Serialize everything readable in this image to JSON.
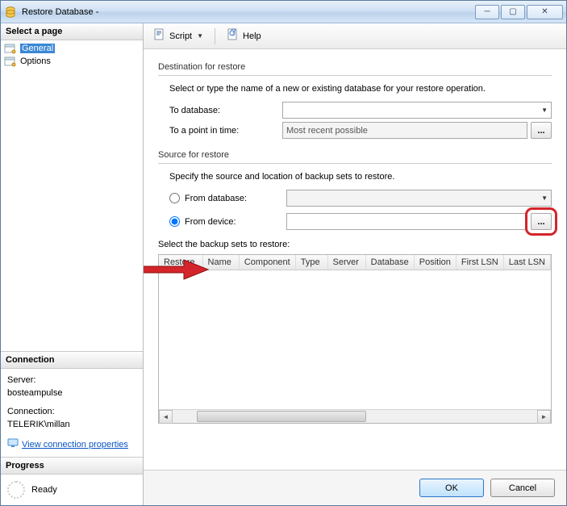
{
  "window": {
    "title": "Restore Database -"
  },
  "sidebar": {
    "selectPage": "Select a page",
    "pages": [
      {
        "label": "General",
        "selected": true
      },
      {
        "label": "Options",
        "selected": false
      }
    ],
    "connectionHeader": "Connection",
    "serverLabel": "Server:",
    "serverValue": "bosteampulse",
    "connectionLabel": "Connection:",
    "connectionValue": "TELERIK\\millan",
    "viewConnProps": "View connection properties",
    "progressHeader": "Progress",
    "progressStatus": "Ready"
  },
  "toolbar": {
    "script": "Script",
    "help": "Help"
  },
  "dest": {
    "group": "Destination for restore",
    "instruction": "Select or type the name of a new or existing database for your restore operation.",
    "toDatabaseLabel": "To database:",
    "toDatabaseValue": "",
    "toPointLabel": "To a point in time:",
    "toPointValue": "Most recent possible"
  },
  "source": {
    "group": "Source for restore",
    "instruction": "Specify the source and location of backup sets to restore.",
    "fromDatabaseLabel": "From database:",
    "fromDeviceLabel": "From device:",
    "selectedRadio": "device",
    "deviceValue": "",
    "backupSetsLabel": "Select the backup sets to restore:",
    "columns": [
      "Restore",
      "Name",
      "Component",
      "Type",
      "Server",
      "Database",
      "Position",
      "First LSN",
      "Last LSN"
    ]
  },
  "buttons": {
    "ok": "OK",
    "cancel": "Cancel"
  },
  "ellipsis": "..."
}
